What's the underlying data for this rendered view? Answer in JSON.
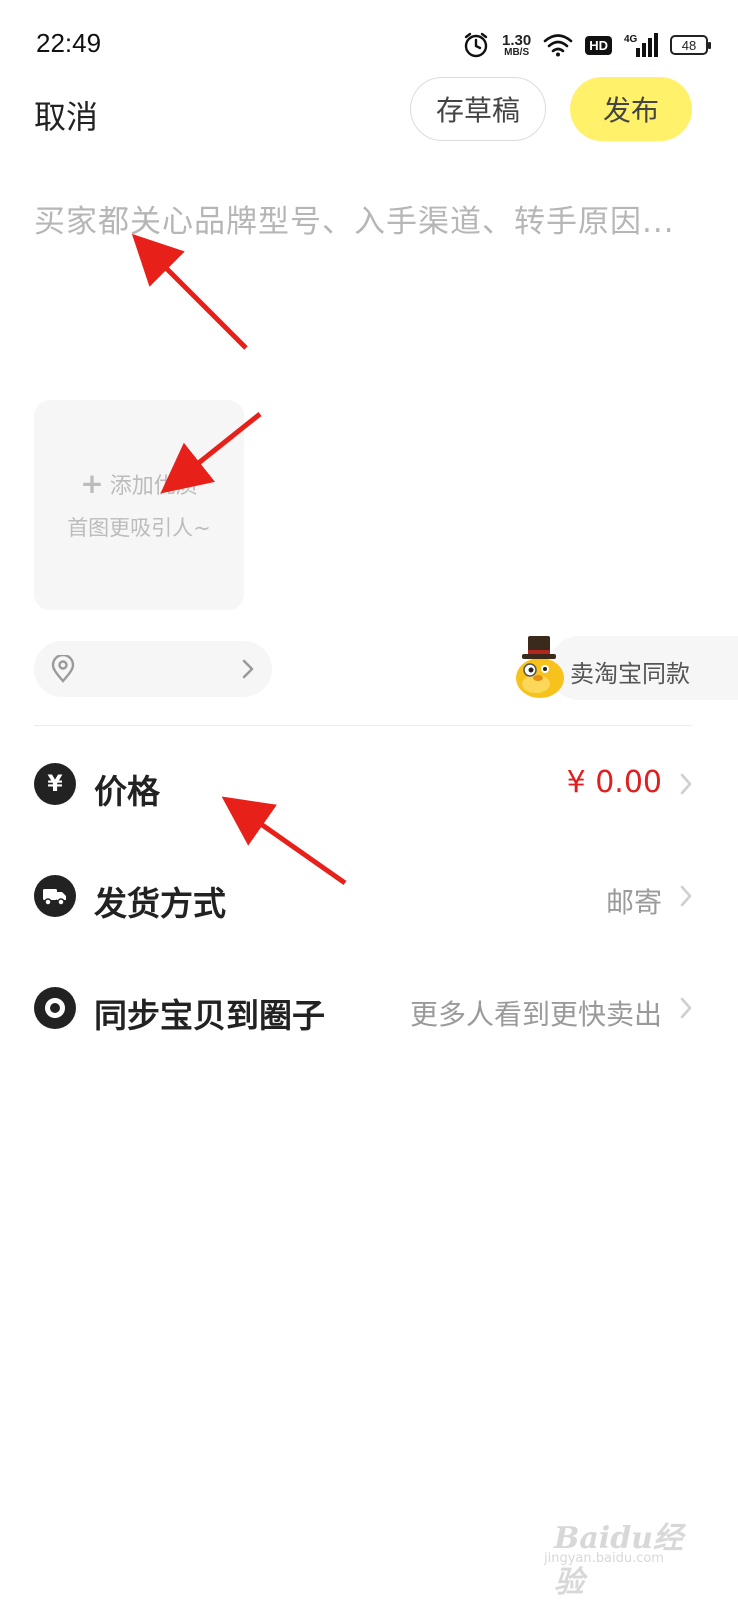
{
  "status_bar": {
    "time": "22:49",
    "net_speed_value": "1.30",
    "net_speed_unit": "MB/S",
    "hd_label": "HD",
    "network_label": "4G",
    "battery": "48",
    "icons": [
      "alarm-icon",
      "wifi-icon",
      "signal-icon",
      "battery-icon"
    ]
  },
  "top_bar": {
    "cancel_label": "取消",
    "draft_label": "存草稿",
    "publish_label": "发布",
    "publish_color": "#fff26a"
  },
  "description": {
    "placeholder": "买家都关心品牌型号、入手渠道、转手原因..."
  },
  "add_photo": {
    "plus": "+",
    "line1": "添加优质",
    "line2": "首图更吸引人~"
  },
  "location": {
    "icon": "location-pin-icon"
  },
  "taobao_same": {
    "label": "卖淘宝同款",
    "mascot": "mascot-icon"
  },
  "rows": {
    "price": {
      "icon": "yuan-icon",
      "glyph": "¥",
      "label": "价格",
      "value": "¥ 0.00",
      "value_color": "#e02020"
    },
    "shipping": {
      "icon": "truck-icon",
      "label": "发货方式",
      "value": "邮寄"
    },
    "sync": {
      "icon": "circle-icon",
      "label": "同步宝贝到圈子",
      "value": "更多人看到更快卖出"
    }
  },
  "watermark": {
    "text": "Baidu经验",
    "url": "jingyan.baidu.com"
  },
  "annotation_color": "#e8201a"
}
